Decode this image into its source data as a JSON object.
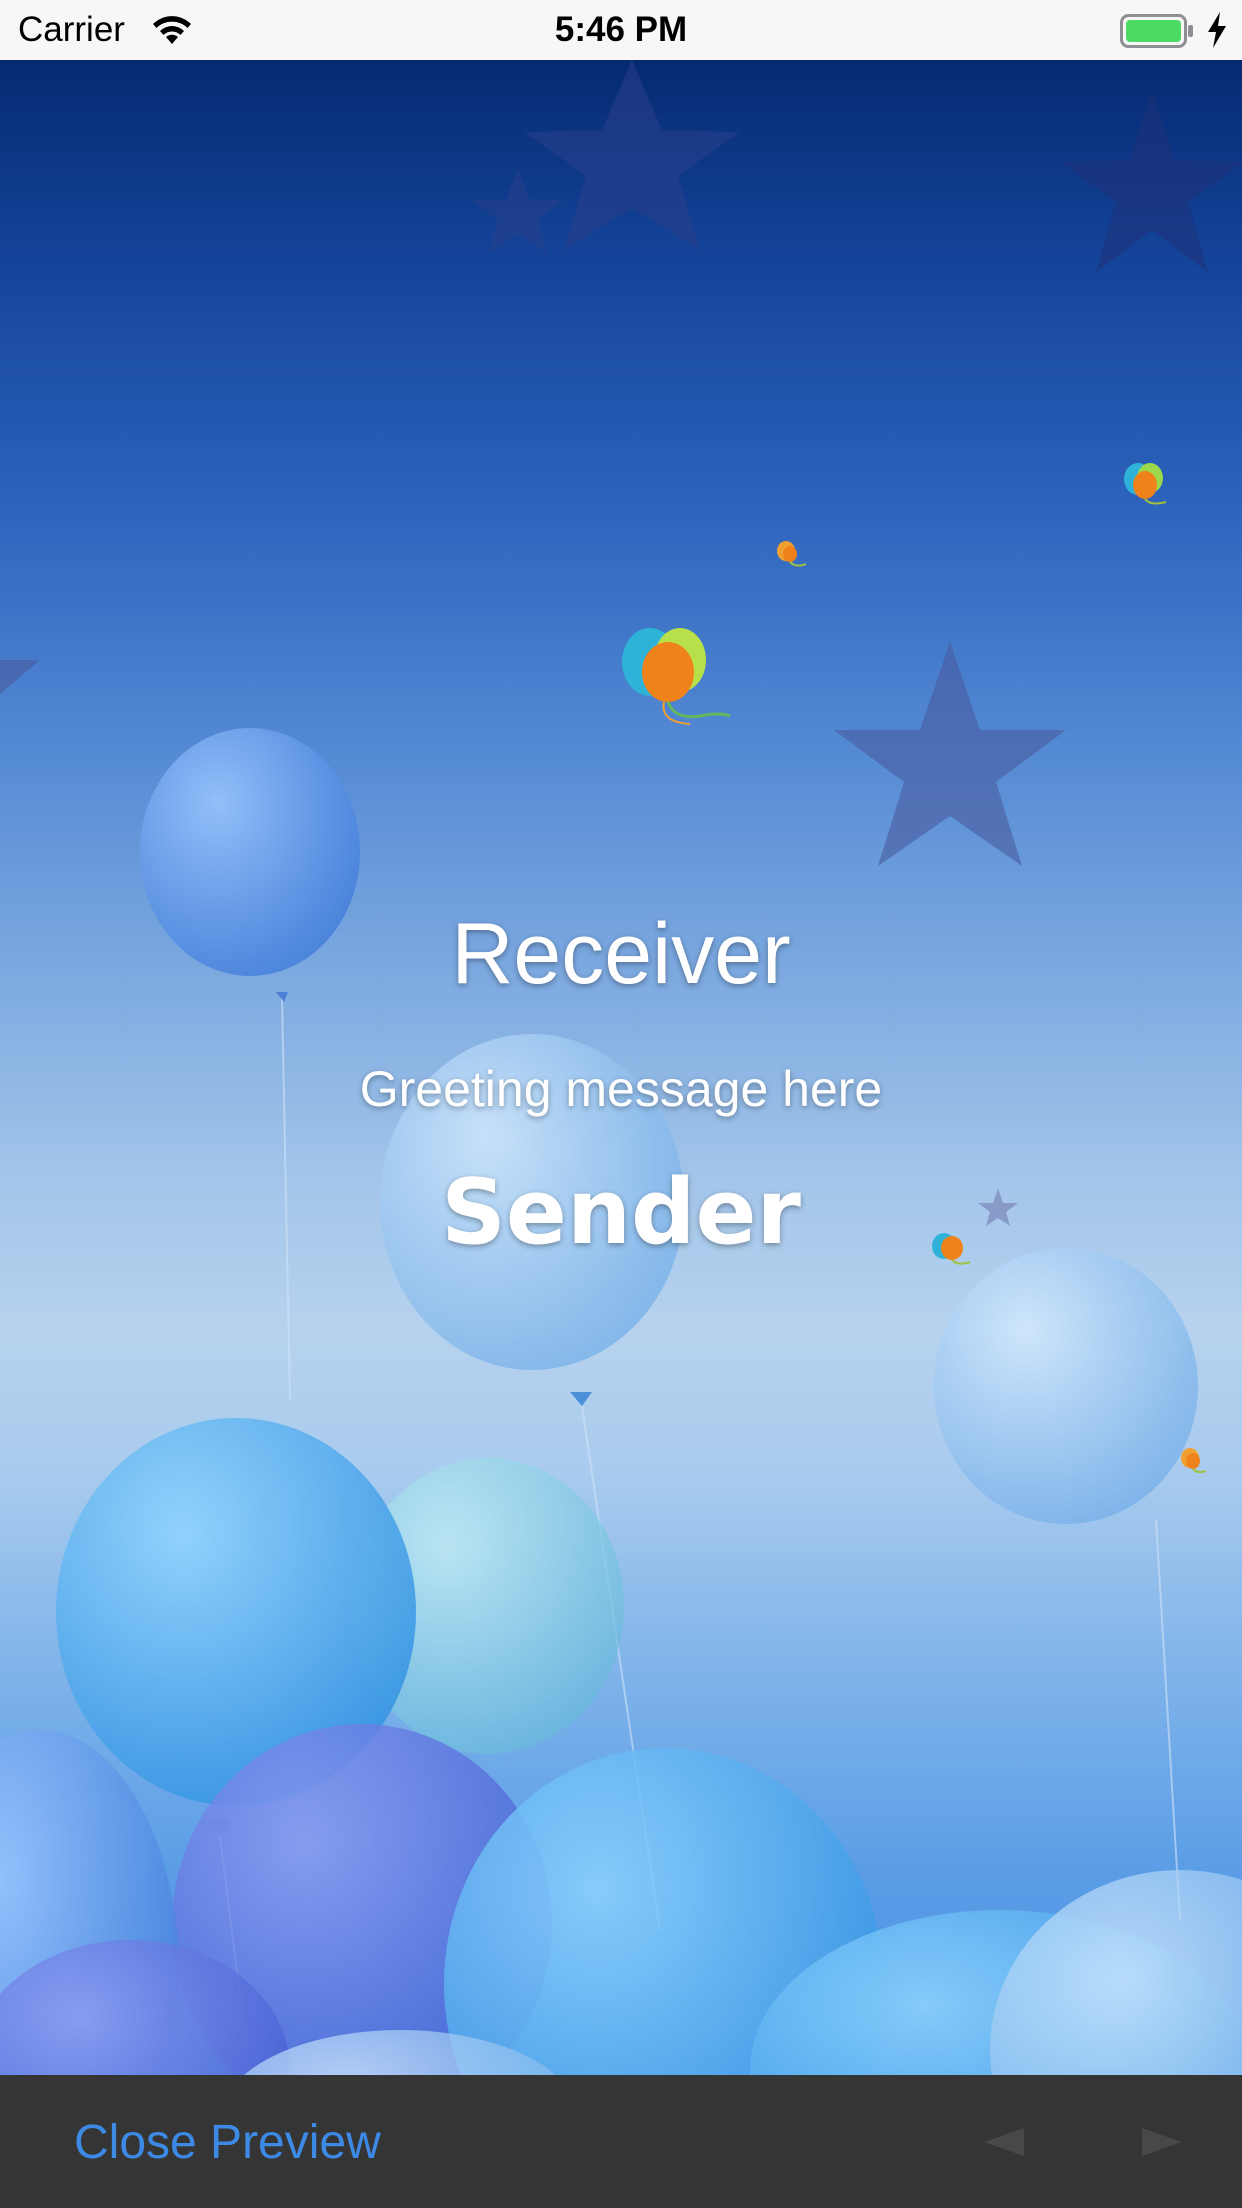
{
  "status_bar": {
    "carrier": "Carrier",
    "time": "5:46 PM",
    "icons": [
      "wifi-icon",
      "battery-icon",
      "charging-bolt-icon"
    ],
    "battery_color": "#4cd964"
  },
  "card": {
    "receiver": "Receiver",
    "greeting": "Greeting message here",
    "sender": "Sender"
  },
  "toolbar": {
    "close_label": "Close Preview",
    "close_color": "#3d8ae6",
    "prev_icon": "triangle-left-icon",
    "next_icon": "triangle-right-icon",
    "background": "#353535"
  }
}
